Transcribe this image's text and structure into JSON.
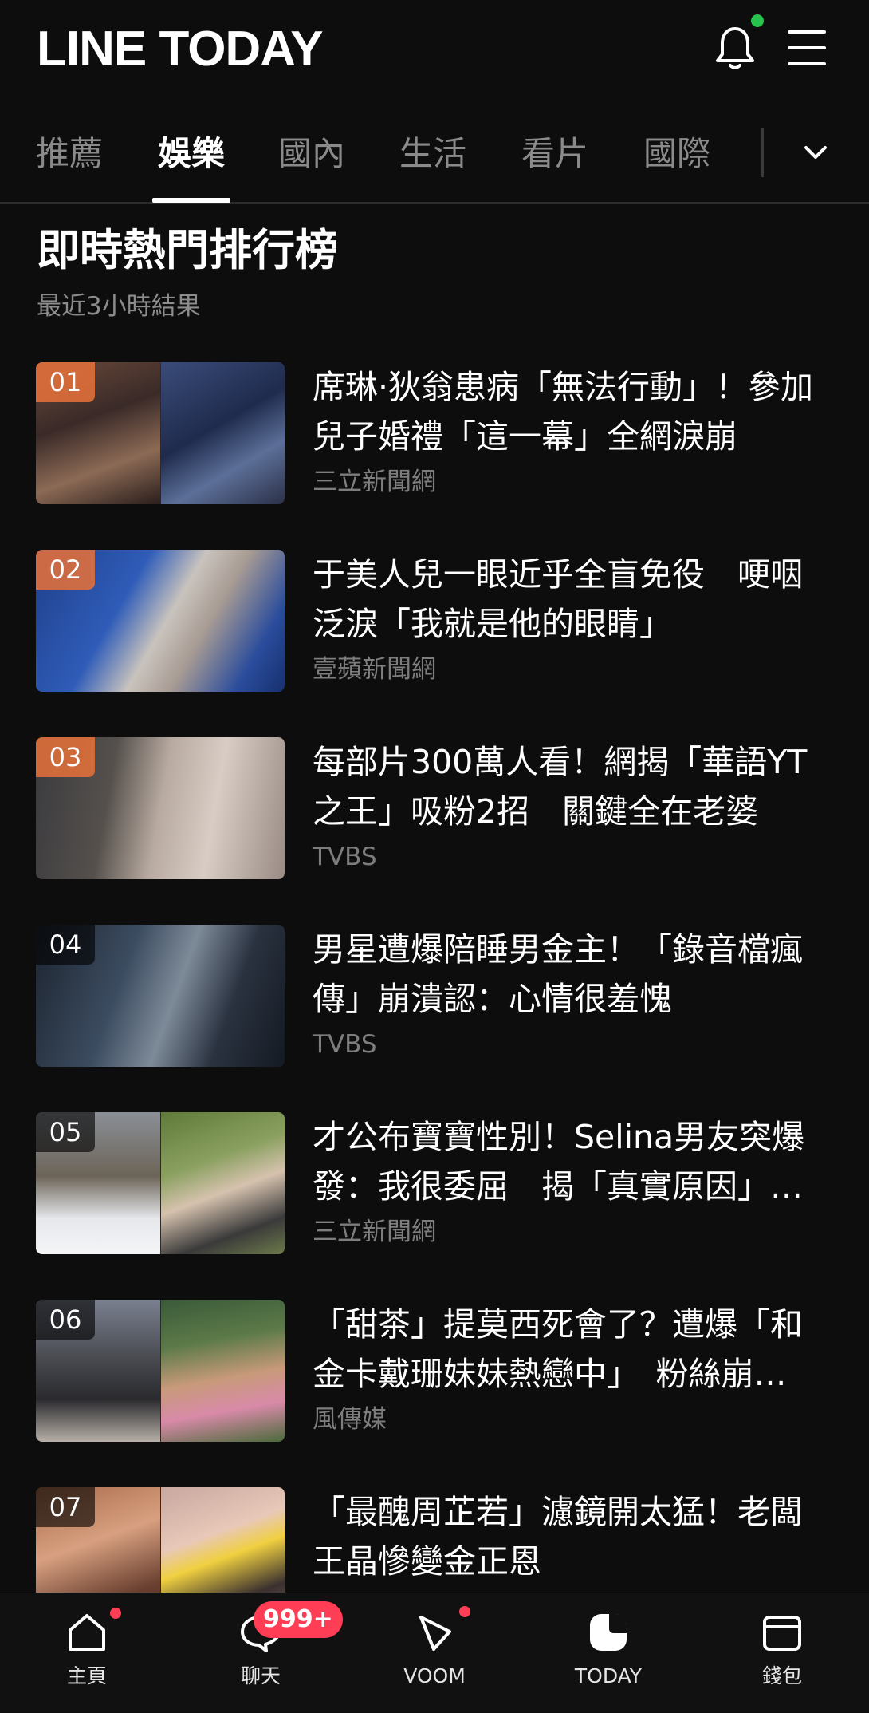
{
  "header": {
    "logo": "LINE TODAY",
    "notification_dot_color": "#27c24c"
  },
  "tabs": [
    {
      "label": "推薦",
      "active": false
    },
    {
      "label": "娛樂",
      "active": true
    },
    {
      "label": "國內",
      "active": false
    },
    {
      "label": "生活",
      "active": false
    },
    {
      "label": "看片",
      "active": false
    },
    {
      "label": "國際",
      "active": false
    }
  ],
  "ranking": {
    "title": "即時熱門排行榜",
    "subtitle": "最近3小時結果",
    "items": [
      {
        "rank": "01",
        "headline": "席琳·狄翁患病「無法行動」！參加兒子婚禮「這一幕」全網淚崩",
        "source": "三立新聞網"
      },
      {
        "rank": "02",
        "headline": "于美人兒一眼近乎全盲免役　哽咽泛淚「我就是他的眼睛」",
        "source": "壹蘋新聞網"
      },
      {
        "rank": "03",
        "headline": "每部片300萬人看！網揭「華語YT之王」吸粉2招　關鍵全在老婆",
        "source": "TVBS"
      },
      {
        "rank": "04",
        "headline": "男星遭爆陪睡男金主！「錄音檔瘋傳」崩潰認：心情很羞愧",
        "source": "TVBS"
      },
      {
        "rank": "05",
        "headline": "才公布寶寶性別！Selina男友突爆發：我很委屈　揭「真實原因」…",
        "source": "三立新聞網"
      },
      {
        "rank": "06",
        "headline": "「甜茶」提莫西死會了？遭爆「和金卡戴珊妹妹熱戀中」　粉絲崩…",
        "source": "風傳媒"
      },
      {
        "rank": "07",
        "headline": "「最醜周芷若」濾鏡開太猛！老闆王晶慘變金正恩",
        "source": ""
      }
    ]
  },
  "bottom_nav": {
    "items": [
      {
        "label": "主頁",
        "icon": "home-icon",
        "dot": true
      },
      {
        "label": "聊天",
        "icon": "chat-icon",
        "badge": "999+"
      },
      {
        "label": "VOOM",
        "icon": "voom-icon",
        "dot": true
      },
      {
        "label": "TODAY",
        "icon": "today-icon",
        "active": true
      },
      {
        "label": "錢包",
        "icon": "wallet-icon"
      }
    ]
  },
  "colors": {
    "background": "#0d0d0d",
    "rank_top_badge": "#e2703a",
    "alert_red": "#ff3d55"
  }
}
